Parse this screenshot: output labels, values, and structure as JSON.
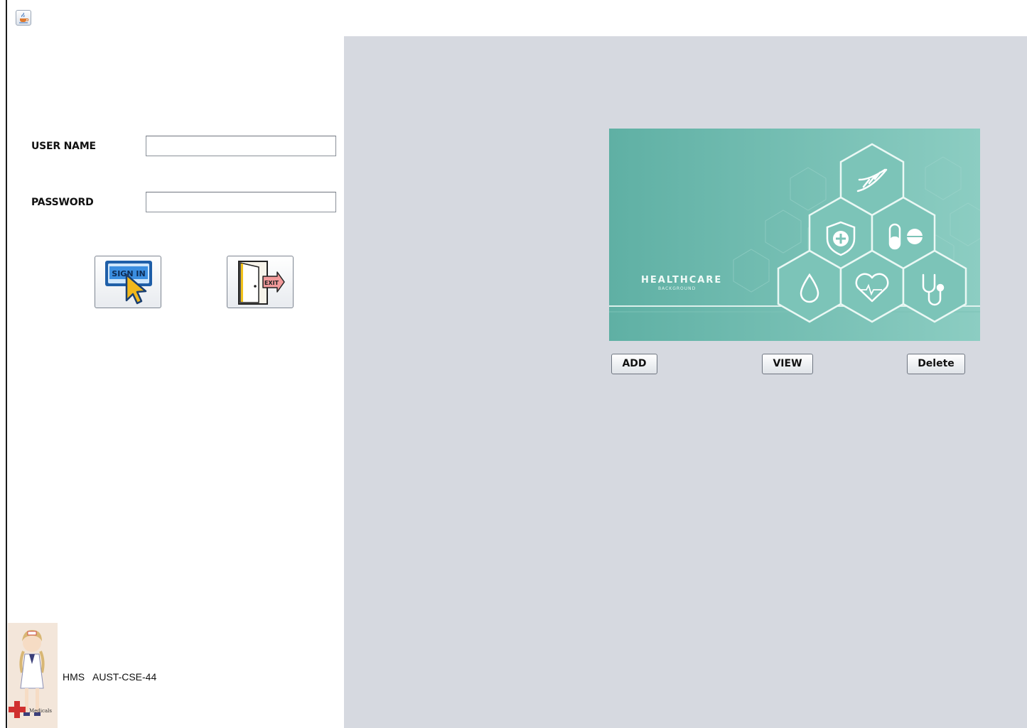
{
  "window": {
    "icon": "java-cup-icon"
  },
  "login": {
    "username_label": "USER NAME",
    "password_label": "PASSWORD",
    "username_value": "",
    "password_value": "",
    "signin_icon": "sign-in-icon",
    "signin_icon_text": "SIGN IN",
    "exit_icon": "exit-door-icon",
    "exit_icon_text": "EXIT"
  },
  "banner": {
    "title": "HEALTHCARE",
    "subtitle": "BACKGROUND",
    "icons": [
      "dna-icon",
      "shield-plus-icon",
      "pill-icon",
      "drop-icon",
      "heart-pulse-icon",
      "stethoscope-icon"
    ]
  },
  "actions": {
    "add": "ADD",
    "view": "VIEW",
    "delete": "Delete"
  },
  "footer": {
    "text": "HMS   AUST-CSE-44",
    "mascot_text": "Medicals"
  },
  "colors": {
    "panel": "#d6d9e0",
    "banner": "#7fc4b8",
    "accent_blue": "#2f7fd0"
  }
}
